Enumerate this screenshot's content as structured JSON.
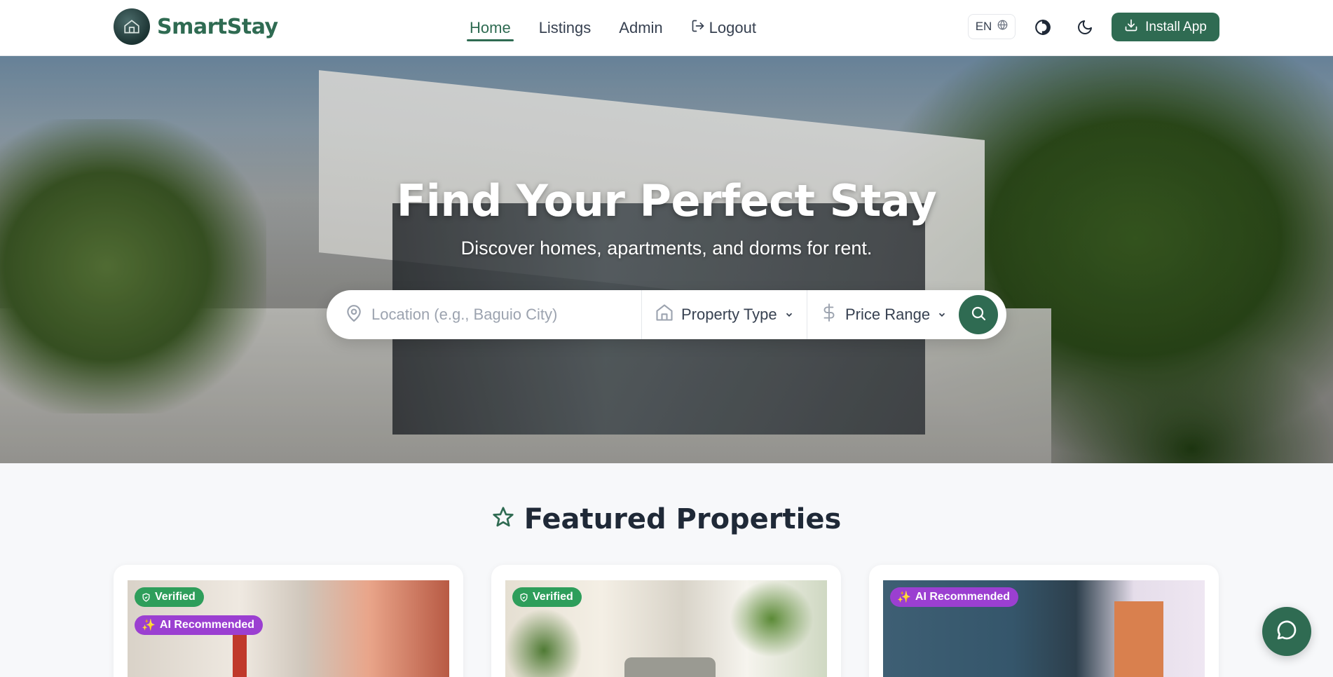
{
  "app": {
    "name": "SmartStay"
  },
  "nav": {
    "items": [
      {
        "label": "Home",
        "active": true
      },
      {
        "label": "Listings"
      },
      {
        "label": "Admin"
      },
      {
        "label": "Logout",
        "icon": "logout-icon"
      }
    ]
  },
  "header": {
    "language": "EN",
    "install_label": "Install App"
  },
  "hero": {
    "title": "Find Your Perfect Stay",
    "subtitle": "Discover homes, apartments, and dorms for rent."
  },
  "search": {
    "location_placeholder": "Location (e.g., Baguio City)",
    "property_type_label": "Property Type",
    "price_range_label": "Price Range"
  },
  "featured": {
    "title": "Featured Properties",
    "cards": [
      {
        "badges": [
          "Verified",
          "AI Recommended"
        ]
      },
      {
        "badges": [
          "Verified"
        ]
      },
      {
        "badges": [
          "AI Recommended"
        ]
      }
    ]
  },
  "colors": {
    "brand": "#2f6b52",
    "verified": "#2e9e5b",
    "ai": "#9b3fd1"
  }
}
